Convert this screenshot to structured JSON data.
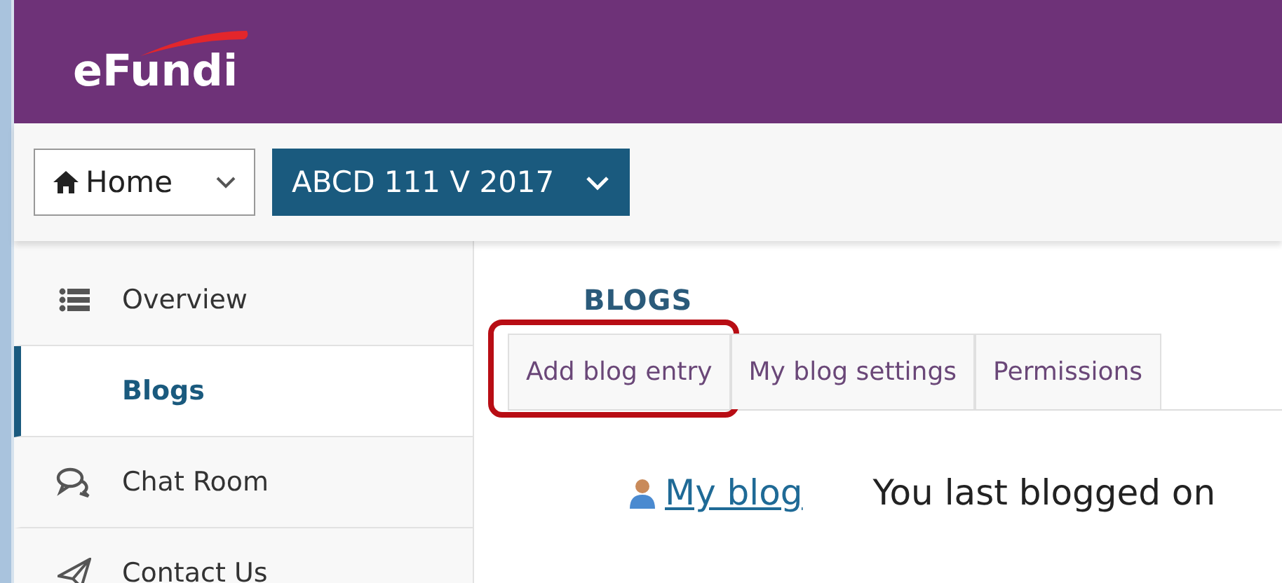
{
  "header": {
    "logo": "eFundi"
  },
  "toolbar": {
    "home_menu": "Home",
    "site_menu": "ABCD 111 V 2017"
  },
  "sidebar": {
    "items": [
      {
        "label": "Overview",
        "selected": false
      },
      {
        "label": "Blogs",
        "selected": true
      },
      {
        "label": "Chat Room",
        "selected": false
      },
      {
        "label": "Contact Us",
        "selected": false
      }
    ]
  },
  "main": {
    "heading": "BLOGS",
    "tabs": [
      {
        "label": "Add blog entry",
        "selected": false,
        "highlighted": true
      },
      {
        "label": "My blog settings",
        "selected": false,
        "highlighted": false
      },
      {
        "label": "Permissions",
        "selected": false,
        "highlighted": false
      }
    ],
    "my_blog_link": "My blog",
    "last_blogged": "You last blogged on"
  }
}
